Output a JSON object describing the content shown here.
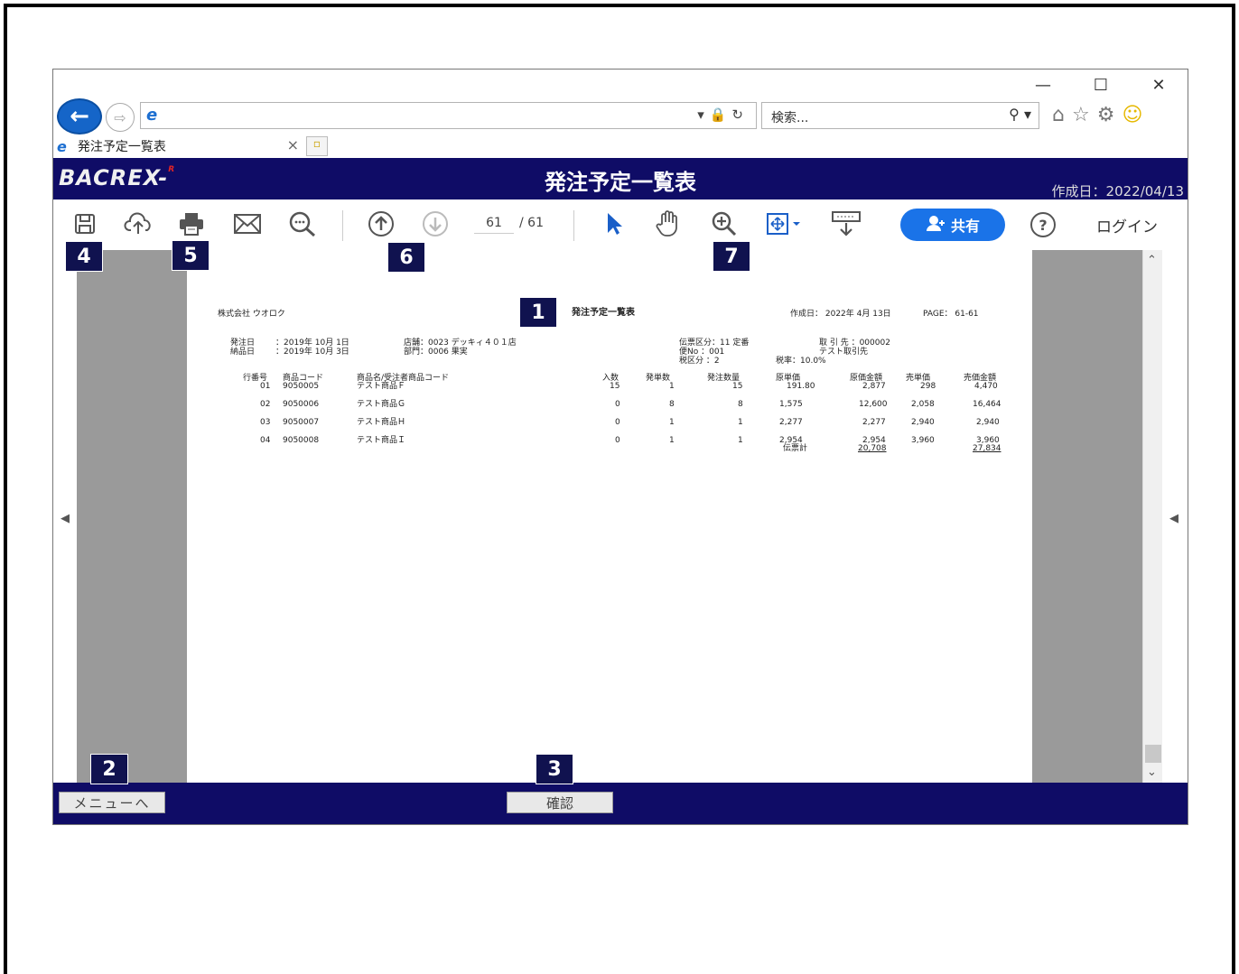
{
  "browser": {
    "search_placeholder": "検索...",
    "tab_title": "発注予定一覧表"
  },
  "app": {
    "logo_main": "BACREX-",
    "logo_r": "R",
    "title": "発注予定一覧表",
    "created_date": "作成日：2022/04/13"
  },
  "toolbar": {
    "page_current": "61",
    "page_total": "/ 61",
    "share_label": "共有",
    "help_label": "?",
    "login_label": "ログイン"
  },
  "report": {
    "company": "株式会社 ウオロク",
    "title": "発注予定一覧表",
    "created": "作成日： 2022年 4月 13日",
    "page": "PAGE： 61-61",
    "order_date_label": "発注日",
    "order_date": "：2019年 10月 1日",
    "delivery_date_label": "納品日",
    "delivery_date": "：2019年 10月 3日",
    "store": "店舗：0023 デッキィ４０１店",
    "dept": "部門：0006 果実",
    "slip_type": "伝票区分：11 定番",
    "flight": "便No ：001",
    "tax_type": "税区分 ：2",
    "tax_rate": "税率：10.0%",
    "supplier": "取 引 先 ：000002",
    "supplier_name": "テスト取引先",
    "headers": {
      "line_no": "行番号",
      "item_code": "商品コード",
      "item_name": "商品名/受注者商品コード",
      "irisu": "入数",
      "units": "発単数",
      "qty": "発注数量",
      "cost": "原単価",
      "cost_amt": "原価金額",
      "price": "売単価",
      "price_amt": "売価金額"
    },
    "rows": [
      {
        "line": "01",
        "code": "9050005",
        "name": "テスト商品Ｆ",
        "irisu": "15",
        "units": "1",
        "qty": "15",
        "cost": "191.80",
        "cost_amt": "2,877",
        "price": "298",
        "price_amt": "4,470"
      },
      {
        "line": "02",
        "code": "9050006",
        "name": "テスト商品Ｇ",
        "irisu": "0",
        "units": "8",
        "qty": "8",
        "cost": "1,575",
        "cost_amt": "12,600",
        "price": "2,058",
        "price_amt": "16,464"
      },
      {
        "line": "03",
        "code": "9050007",
        "name": "テスト商品Ｈ",
        "irisu": "0",
        "units": "1",
        "qty": "1",
        "cost": "2,277",
        "cost_amt": "2,277",
        "price": "2,940",
        "price_amt": "2,940"
      },
      {
        "line": "04",
        "code": "9050008",
        "name": "テスト商品Ｉ",
        "irisu": "0",
        "units": "1",
        "qty": "1",
        "cost": "2,954",
        "cost_amt": "2,954",
        "price": "3,960",
        "price_amt": "3,960"
      }
    ],
    "total_label": "伝票計",
    "total_cost": "20,708",
    "total_price": "27,834"
  },
  "bottom": {
    "menu_label": "メニューへ",
    "confirm_label": "確認"
  },
  "markers": [
    "1",
    "2",
    "3",
    "4",
    "5",
    "6",
    "7"
  ]
}
